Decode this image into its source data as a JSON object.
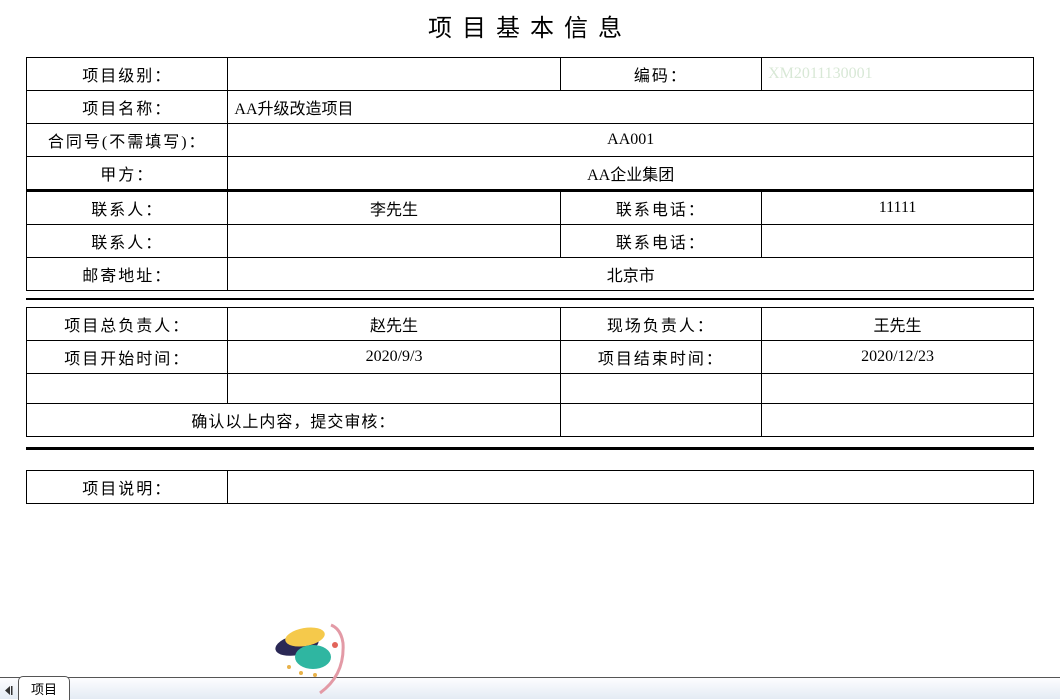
{
  "title": "项目基本信息",
  "labels": {
    "level": "项目级别：",
    "code": "编码：",
    "name": "项目名称：",
    "contract": "合同号(不需填写)：",
    "partyA": "甲方：",
    "contact1": "联系人：",
    "phone1": "联系电话：",
    "contact2": "联系人：",
    "phone2": "联系电话：",
    "address": "邮寄地址：",
    "pm": "项目总负责人：",
    "siteLead": "现场负责人：",
    "startDate": "项目开始时间：",
    "endDate": "项目结束时间：",
    "confirmPrompt": "确认以上内容，提交审核：",
    "description": "项目说明："
  },
  "values": {
    "level": "",
    "codePlaceholder": "XM2011130001",
    "name": "AA升级改造项目",
    "contract": "AA001",
    "partyA": "AA企业集团",
    "contact1": "李先生",
    "phone1": "11111",
    "contact2": "",
    "phone2": "",
    "address": "北京市",
    "pm": "赵先生",
    "siteLead": "王先生",
    "startDate": "2020/9/3",
    "endDate": "2020/12/23",
    "submit": "",
    "description": ""
  },
  "tab": "项目"
}
